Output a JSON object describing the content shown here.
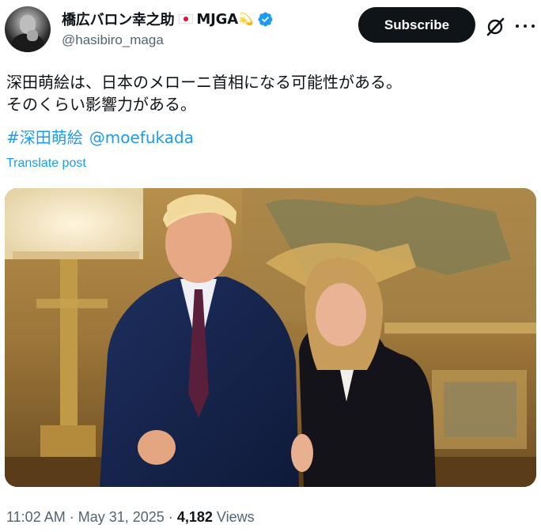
{
  "author": {
    "display_name": "橋広バロン幸之助",
    "name_suffix": "MJGA",
    "flag_icon": "japan-flag-icon",
    "star_icon": "dizzy-star-emoji-icon",
    "handle": "@hasibiro_maga",
    "verified": true,
    "verified_color": "#1d9bf0"
  },
  "actions": {
    "subscribe_label": "Subscribe",
    "grok_icon": "grok-icon",
    "more_icon": "more-icon"
  },
  "tweet": {
    "lines": [
      "深田萌絵は、日本のメローニ首相になる可能性がある。",
      "そのくらい影響力がある。"
    ],
    "hashtag": "#深田萌絵",
    "mention": "@moefukada",
    "translate_label": "Translate post",
    "link_color": "#1d9bf0"
  },
  "meta": {
    "time": "11:02 AM",
    "separator": "·",
    "date": "May 31, 2025",
    "views_count": "4,182",
    "views_label": "Views"
  }
}
